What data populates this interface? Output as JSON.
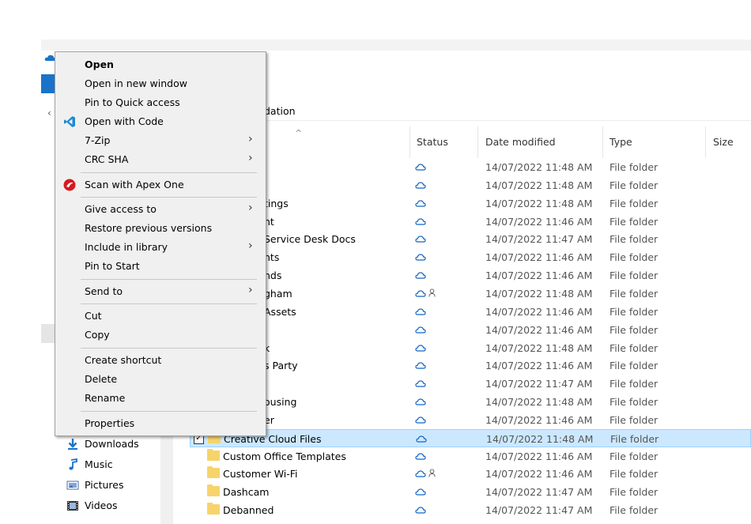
{
  "breadcrumb_fragment": "dation",
  "columns": {
    "status": "Status",
    "date": "Date modified",
    "type": "Type",
    "size": "Size"
  },
  "rows": [
    {
      "name": "",
      "date": "14/07/2022 11:48 AM",
      "type": "File folder",
      "shared": false
    },
    {
      "name": "",
      "date": "14/07/2022 11:48 AM",
      "type": "File folder",
      "shared": false
    },
    {
      "name": "tings",
      "date": "14/07/2022 11:48 AM",
      "type": "File folder",
      "shared": false
    },
    {
      "name": "nt",
      "date": "14/07/2022 11:46 AM",
      "type": "File folder",
      "shared": false
    },
    {
      "name": "Service Desk Docs",
      "date": "14/07/2022 11:47 AM",
      "type": "File folder",
      "shared": false
    },
    {
      "name": "nts",
      "date": "14/07/2022 11:46 AM",
      "type": "File folder",
      "shared": false
    },
    {
      "name": "nds",
      "date": "14/07/2022 11:46 AM",
      "type": "File folder",
      "shared": false
    },
    {
      "name": "gham",
      "date": "14/07/2022 11:48 AM",
      "type": "File folder",
      "shared": true
    },
    {
      "name": "Assets",
      "date": "14/07/2022 11:46 AM",
      "type": "File folder",
      "shared": false
    },
    {
      "name": "",
      "date": "14/07/2022 11:46 AM",
      "type": "File folder",
      "shared": false
    },
    {
      "name": "k",
      "date": "14/07/2022 11:48 AM",
      "type": "File folder",
      "shared": false
    },
    {
      "name": "s Party",
      "date": "14/07/2022 11:46 AM",
      "type": "File folder",
      "shared": false
    },
    {
      "name": "",
      "date": "14/07/2022 11:47 AM",
      "type": "File folder",
      "shared": false
    },
    {
      "name": "ousing",
      "date": "14/07/2022 11:48 AM",
      "type": "File folder",
      "shared": false
    },
    {
      "name": "er",
      "date": "14/07/2022 11:46 AM",
      "type": "File folder",
      "shared": false
    },
    {
      "name": "Creative Cloud Files",
      "date": "14/07/2022 11:48 AM",
      "type": "File folder",
      "shared": false,
      "selected": true
    },
    {
      "name": "Custom Office Templates",
      "date": "14/07/2022 11:46 AM",
      "type": "File folder",
      "shared": false
    },
    {
      "name": "Customer Wi-Fi",
      "date": "14/07/2022 11:46 AM",
      "type": "File folder",
      "shared": true
    },
    {
      "name": "Dashcam",
      "date": "14/07/2022 11:47 AM",
      "type": "File folder",
      "shared": false
    },
    {
      "name": "Debanned",
      "date": "14/07/2022 11:47 AM",
      "type": "File folder",
      "shared": false
    }
  ],
  "nav": [
    {
      "label": "Downloads",
      "icon": "download-arrow-icon"
    },
    {
      "label": "Music",
      "icon": "music-note-icon"
    },
    {
      "label": "Pictures",
      "icon": "pictures-icon"
    },
    {
      "label": "Videos",
      "icon": "videos-icon"
    }
  ],
  "menu": {
    "open": "Open",
    "open_new_window": "Open in new window",
    "pin_quick_access": "Pin to Quick access",
    "open_with_code": "Open with Code",
    "seven_zip": "7-Zip",
    "crc_sha": "CRC SHA",
    "scan_apex": "Scan with Apex One",
    "give_access": "Give access to",
    "restore_versions": "Restore previous versions",
    "include_library": "Include in library",
    "pin_start": "Pin to Start",
    "send_to": "Send to",
    "cut": "Cut",
    "copy": "Copy",
    "create_shortcut": "Create shortcut",
    "delete": "Delete",
    "rename": "Rename",
    "properties": "Properties"
  },
  "colors": {
    "accent": "#1a73c9",
    "selection": "#cce8ff",
    "folder": "#f7d36b",
    "cloud_status": "#1565c0"
  }
}
